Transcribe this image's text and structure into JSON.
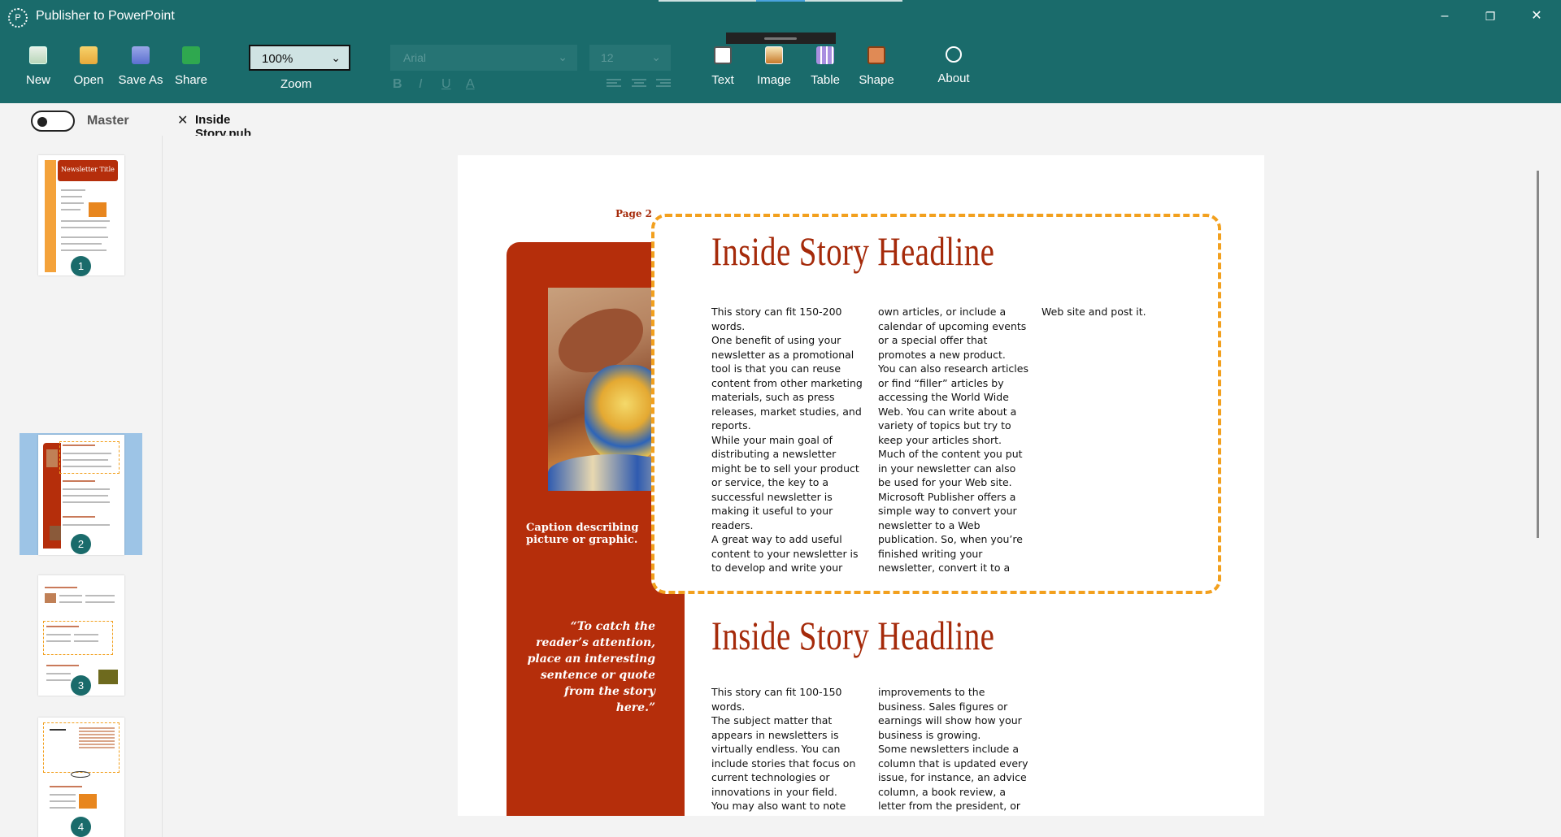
{
  "app": {
    "title": "Publisher to PowerPoint",
    "window_controls": [
      "–",
      "❐",
      "✕"
    ]
  },
  "ribbon": {
    "file": [
      {
        "label": "New",
        "icon": "new-document-icon"
      },
      {
        "label": "Open",
        "icon": "open-folder-icon"
      },
      {
        "label": "Save As",
        "icon": "save-icon"
      },
      {
        "label": "Share",
        "icon": "share-icon"
      }
    ],
    "zoom": {
      "value": "100%",
      "label": "Zoom"
    },
    "font": {
      "family": "Arial",
      "size": "12",
      "bold": "B",
      "italic": "I",
      "underline": "U",
      "color": "A"
    },
    "insert": [
      {
        "label": "Text",
        "icon": "text-box-icon"
      },
      {
        "label": "Image",
        "icon": "image-icon"
      },
      {
        "label": "Table",
        "icon": "table-icon"
      },
      {
        "label": "Shape",
        "icon": "shape-icon"
      }
    ],
    "about": {
      "label": "About",
      "icon": "info-icon"
    }
  },
  "tabs": {
    "master_label": "Master",
    "master_on": false,
    "document": "Inside Story.pub",
    "close": "✕"
  },
  "thumbnails": [
    {
      "number": "1",
      "title": "Newsletter Title",
      "selected": false
    },
    {
      "number": "2",
      "selected": true
    },
    {
      "number": "3",
      "selected": false
    },
    {
      "number": "4",
      "selected": false
    }
  ],
  "page": {
    "page_label": "Page 2",
    "caption": "Caption describing picture or graphic.",
    "quote": "“To catch the reader’s attention, place an interesting sentence or quote from the story here.”",
    "story1": {
      "headline": "Inside Story Headline",
      "col1": [
        "This story can fit 150-200 words.",
        "One benefit of using your newsletter as a promotional tool is that you can reuse content from other marketing materials, such as press releases, market studies, and reports.",
        "While your main goal of distributing a newsletter might be to sell your product or service, the key to a successful newsletter is making it useful to your readers.",
        "A great way to add useful content to your newsletter is to develop and write your"
      ],
      "col2": [
        "own articles, or include a calendar of upcoming events or a special offer that promotes a new product.",
        "You can also research articles or find “filler” articles by accessing the World Wide Web. You can write about a variety of topics but try to keep your articles short.",
        "Much of the content you put in your newsletter can also be used for your Web site. Microsoft Publisher offers a simple way to convert your newsletter to a Web publication. So, when you’re finished writing your newsletter, convert it to a"
      ],
      "col3": [
        "Web site and post it."
      ]
    },
    "story2": {
      "headline": "Inside Story Headline",
      "col1": [
        "This story can fit 100-150 words.",
        "The subject matter that appears in newsletters is virtually endless. You can include stories that focus on current technologies or innovations in your field.",
        "You may also want to note business or economic trends."
      ],
      "col2": [
        "improvements to the business. Sales figures or earnings will show how your business is growing.",
        "Some newsletters include a column that is updated every issue, for instance, an advice column, a book review, a letter from the president, or an editorial. You can also"
      ]
    }
  },
  "colors": {
    "ribbon_bg": "#1a6b6b",
    "accent_red": "#b52e0b",
    "headline_red": "#a52a0a",
    "dashed_orange": "#f2a01e",
    "tab_underline": "#1a73c8",
    "selected_thumb": "#9dc4e6"
  }
}
